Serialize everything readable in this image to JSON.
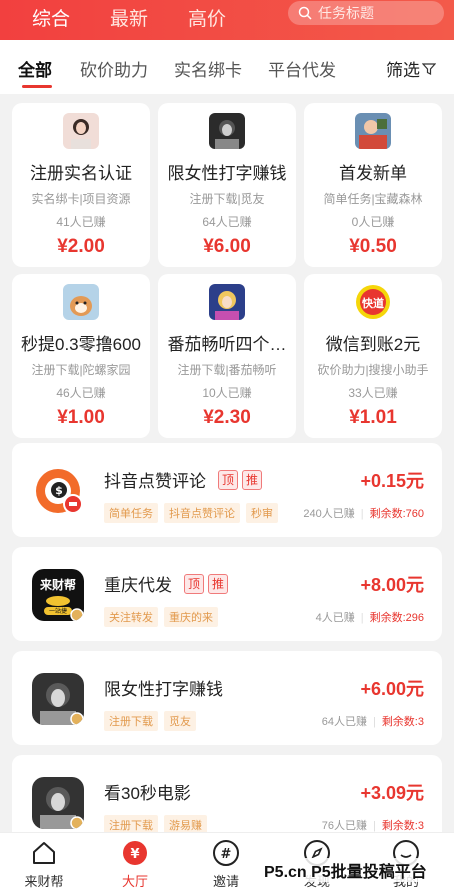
{
  "header": {
    "tabs": [
      "综合",
      "最新",
      "高价"
    ],
    "search_placeholder": "任务标题"
  },
  "categories": {
    "items": [
      "全部",
      "砍价助力",
      "实名绑卡",
      "平台代发"
    ],
    "filter_label": "筛选"
  },
  "grid_cards": [
    {
      "title": "注册实名认证",
      "sub": "实名绑卡|项目资源",
      "earned": "41人已赚",
      "price": "¥2.00"
    },
    {
      "title": "限女性打字赚钱",
      "sub": "注册下载|觅友",
      "earned": "64人已赚",
      "price": "¥6.00"
    },
    {
      "title": "首发新单",
      "sub": "简单任务|宝藏森林",
      "earned": "0人已赚",
      "price": "¥0.50"
    },
    {
      "title": "秒提0.3零撸600",
      "sub": "注册下载|陀螺家园",
      "earned": "46人已赚",
      "price": "¥1.00"
    },
    {
      "title": "番茄畅听四个…",
      "sub": "注册下载|番茄畅听",
      "earned": "10人已赚",
      "price": "¥2.30"
    },
    {
      "title": "微信到账2元",
      "sub": "砍价助力|搜搜小助手",
      "earned": "33人已赚",
      "price": "¥1.01"
    }
  ],
  "list_cards": [
    {
      "title": "抖音点赞评论",
      "badges": [
        "顶",
        "推"
      ],
      "price": "+0.15元",
      "tags": [
        "简单任务",
        "抖音点赞评论",
        "秒审"
      ],
      "earned": "240人已赚",
      "remaining": "剩余数:760"
    },
    {
      "title": "重庆代发",
      "badges": [
        "顶",
        "推"
      ],
      "price": "+8.00元",
      "tags": [
        "关注转发",
        "重庆的来"
      ],
      "earned": "4人已赚",
      "remaining": "剩余数:296"
    },
    {
      "title": "限女性打字赚钱",
      "badges": [],
      "price": "+6.00元",
      "tags": [
        "注册下载",
        "觅友"
      ],
      "earned": "64人已赚",
      "remaining": "剩余数:3"
    },
    {
      "title": "看30秒电影",
      "badges": [],
      "price": "+3.09元",
      "tags": [
        "注册下载",
        "游易赚"
      ],
      "earned": "76人已赚",
      "remaining": "剩余数:3"
    }
  ],
  "avatar_texts": {
    "laicaibang": "来财帮",
    "yizhanlian": "一站捷",
    "kuaidao": "快道"
  },
  "bottom_nav": [
    {
      "label": "来财帮",
      "icon": "home-icon"
    },
    {
      "label": "大厅",
      "icon": "yuan-icon"
    },
    {
      "label": "邀请",
      "icon": "hash-icon"
    },
    {
      "label": "发现",
      "icon": "compass-icon"
    },
    {
      "label": "我的",
      "icon": "chat-icon"
    }
  ],
  "watermark": "P5.cn P5批量投稿平台",
  "colors": {
    "accent": "#e8362f",
    "header": "#f2403f",
    "tag_bg": "#fdf1e4",
    "tag_text": "#e29a4e"
  }
}
